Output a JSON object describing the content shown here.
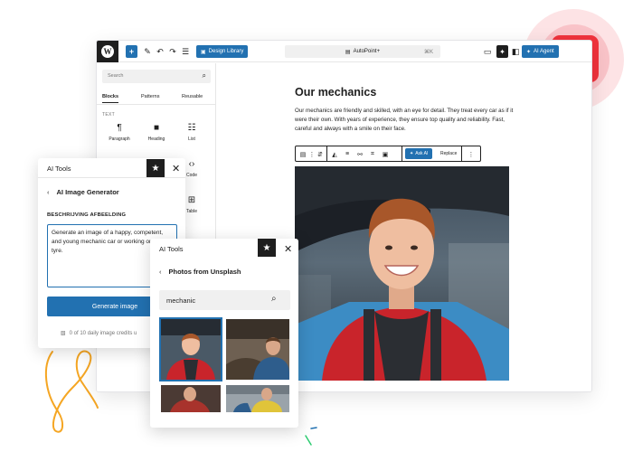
{
  "editor": {
    "toolbar": {
      "design_library": "Design Library",
      "page_title": "AutoPoint+",
      "shortcut": "⌘K",
      "ai_agent": "AI Agent"
    },
    "inserter": {
      "search_placeholder": "Search",
      "tabs": [
        "Blocks",
        "Patterns",
        "Reusable"
      ],
      "category": "TEXT",
      "blocks": [
        "Paragraph",
        "Heading",
        "List",
        "Code",
        "Table"
      ]
    },
    "canvas": {
      "heading": "Our mechanics",
      "paragraph": "Our mechanics are friendly and skilled, with an eye for detail. They treat every car as if it were their own. With years of experience, they ensure top quality and reliability. Fast, careful and always with a smile on their face.",
      "block_toolbar": {
        "ask_ai": "Ask AI",
        "replace": "Replace"
      }
    }
  },
  "image_generator": {
    "panel_title": "AI Tools",
    "subtitle": "AI Image Generator",
    "field_label": "BESCHRIJVING AFBEELDING",
    "prompt_value": "Generate an image of a happy, competent, and young mechanic car or working on a car tyre.",
    "generate_label": "Generate image",
    "credits": "0 of 10 daily image credits u"
  },
  "unsplash": {
    "panel_title": "AI Tools",
    "subtitle": "Photos from Unsplash",
    "search_value": "mechanic"
  },
  "colors": {
    "accent": "#2271b1",
    "dark": "#1e1e1e",
    "badge": "#f0323c",
    "squiggle": "#f5a623",
    "mechanic_shirt": "#c9242b"
  },
  "icons": [
    "wordpress-logo-icon",
    "plus-icon",
    "pen-icon",
    "undo-icon",
    "redo-icon",
    "list-view-icon",
    "search-icon",
    "star-icon",
    "close-icon",
    "back-chevron-icon",
    "image-icon"
  ]
}
